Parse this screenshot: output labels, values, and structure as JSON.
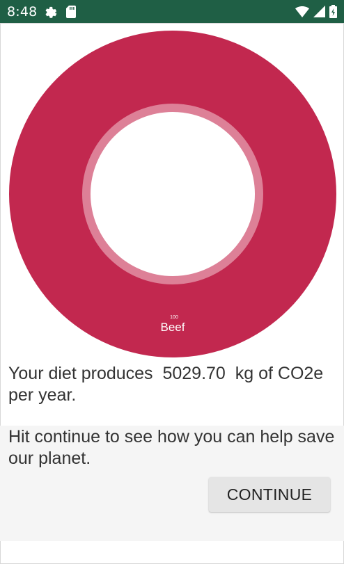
{
  "status_bar": {
    "time": "8:48",
    "icons": [
      "gear-icon",
      "sd-card-icon",
      "wifi-icon",
      "signal-icon",
      "battery-icon"
    ]
  },
  "chart_data": {
    "type": "pie",
    "slices": [
      {
        "label": "Beef",
        "value": 100,
        "value_label": "100",
        "color": "#c2284f"
      }
    ]
  },
  "summary": {
    "prefix": "Your diet produces",
    "value": "5029.70",
    "suffix": "kg of CO2e per year."
  },
  "call_to_action": {
    "text": "Hit continue to see how you can help save our planet.",
    "button_label": "CONTINUE"
  },
  "colors": {
    "status_bar": "#1f5f45",
    "slice": "#c2284f",
    "inner_ring": "#dd8097"
  }
}
